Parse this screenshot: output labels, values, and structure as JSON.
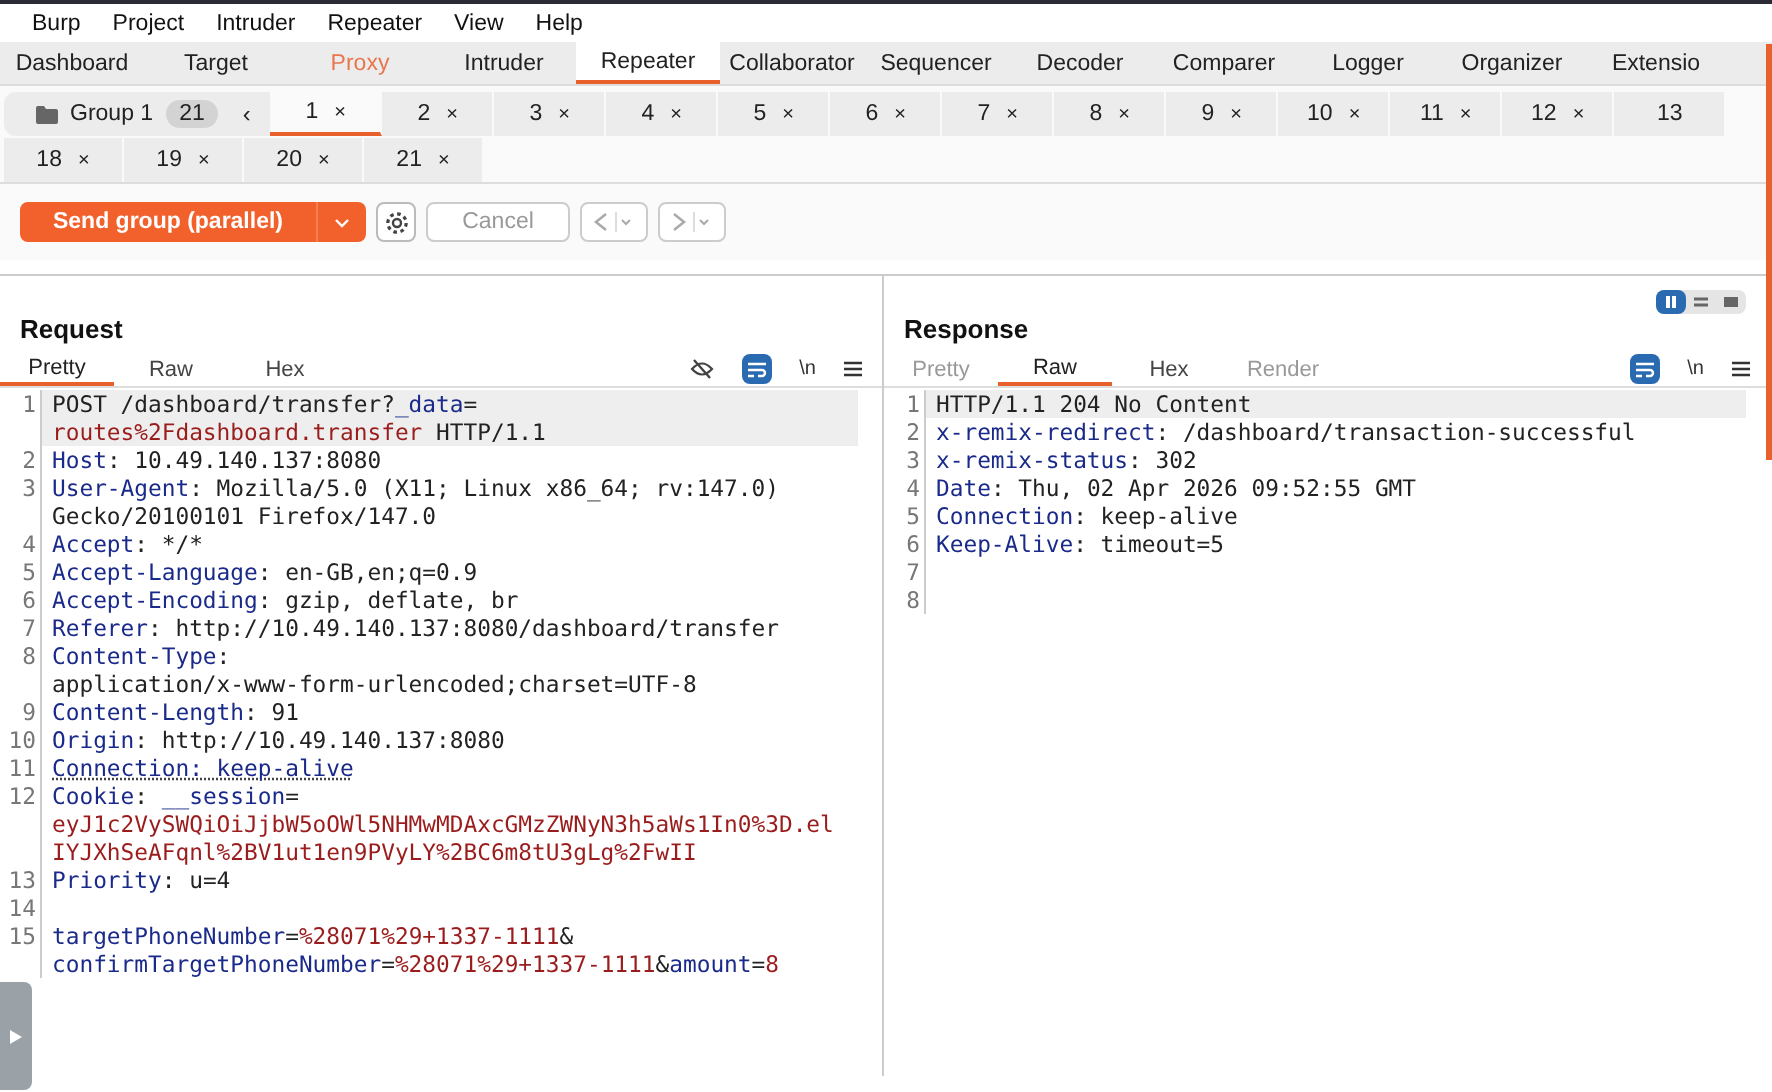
{
  "menu": [
    "Burp",
    "Project",
    "Intruder",
    "Repeater",
    "View",
    "Help"
  ],
  "main_tabs": [
    {
      "label": "Dashboard",
      "selected": false,
      "highlighted": false
    },
    {
      "label": "Target",
      "selected": false,
      "highlighted": false
    },
    {
      "label": "Proxy",
      "selected": false,
      "highlighted": true
    },
    {
      "label": "Intruder",
      "selected": false,
      "highlighted": false
    },
    {
      "label": "Repeater",
      "selected": true,
      "highlighted": false
    },
    {
      "label": "Collaborator",
      "selected": false,
      "highlighted": false
    },
    {
      "label": "Sequencer",
      "selected": false,
      "highlighted": false
    },
    {
      "label": "Decoder",
      "selected": false,
      "highlighted": false
    },
    {
      "label": "Comparer",
      "selected": false,
      "highlighted": false
    },
    {
      "label": "Logger",
      "selected": false,
      "highlighted": false
    },
    {
      "label": "Organizer",
      "selected": false,
      "highlighted": false
    },
    {
      "label": "Extensio",
      "selected": false,
      "highlighted": false
    }
  ],
  "group": {
    "name": "Group 1",
    "count": "21",
    "collapse": "‹"
  },
  "request_tabs_row1": [
    {
      "label": "1",
      "close": "×",
      "selected": true
    },
    {
      "label": "2",
      "close": "×",
      "selected": false
    },
    {
      "label": "3",
      "close": "×",
      "selected": false
    },
    {
      "label": "4",
      "close": "×",
      "selected": false
    },
    {
      "label": "5",
      "close": "×",
      "selected": false
    },
    {
      "label": "6",
      "close": "×",
      "selected": false
    },
    {
      "label": "7",
      "close": "×",
      "selected": false
    },
    {
      "label": "8",
      "close": "×",
      "selected": false
    },
    {
      "label": "9",
      "close": "×",
      "selected": false
    },
    {
      "label": "10",
      "close": "×",
      "selected": false
    },
    {
      "label": "11",
      "close": "×",
      "selected": false
    },
    {
      "label": "12",
      "close": "×",
      "selected": false
    },
    {
      "label": "13",
      "selected": false
    }
  ],
  "request_tabs_row2": [
    {
      "label": "18",
      "close": "×",
      "selected": false
    },
    {
      "label": "19",
      "close": "×",
      "selected": false
    },
    {
      "label": "20",
      "close": "×",
      "selected": false
    },
    {
      "label": "21",
      "close": "×",
      "selected": false
    }
  ],
  "toolbar": {
    "send": "Send group (parallel)",
    "cancel": "Cancel",
    "cancel_disabled": true
  },
  "request": {
    "title": "Request",
    "tabs": [
      {
        "label": "Pretty",
        "selected": true
      },
      {
        "label": "Raw",
        "selected": false
      },
      {
        "label": "Hex",
        "selected": false
      }
    ],
    "newline_toggle": "\\n",
    "lines": [
      {
        "no": "1",
        "rows": [
          {
            "parts": [
              {
                "kind": "plain",
                "text": "POST /dashboard/transfer?"
              },
              {
                "kind": "name",
                "text": "_data"
              },
              {
                "kind": "plain",
                "text": "="
              }
            ]
          },
          {
            "parts": [
              {
                "kind": "value",
                "text": "routes%2Fdashboard.transfer"
              },
              {
                "kind": "plain",
                "text": " HTTP/1.1"
              }
            ]
          }
        ]
      },
      {
        "no": "2",
        "rows": [
          {
            "parts": [
              {
                "kind": "name",
                "text": "Host"
              },
              {
                "kind": "plain",
                "text": ": 10.49.140.137:8080"
              }
            ]
          }
        ]
      },
      {
        "no": "3",
        "rows": [
          {
            "parts": [
              {
                "kind": "name",
                "text": "User-Agent"
              },
              {
                "kind": "plain",
                "text": ": Mozilla/5.0 (X11; Linux x86_64; rv:147.0)"
              }
            ]
          },
          {
            "parts": [
              {
                "kind": "plain",
                "text": "Gecko/20100101 Firefox/147.0"
              }
            ]
          }
        ]
      },
      {
        "no": "4",
        "rows": [
          {
            "parts": [
              {
                "kind": "name",
                "text": "Accept"
              },
              {
                "kind": "plain",
                "text": ": */*"
              }
            ]
          }
        ]
      },
      {
        "no": "5",
        "rows": [
          {
            "parts": [
              {
                "kind": "name",
                "text": "Accept-Language"
              },
              {
                "kind": "plain",
                "text": ": en-GB,en;q=0.9"
              }
            ]
          }
        ]
      },
      {
        "no": "6",
        "rows": [
          {
            "parts": [
              {
                "kind": "name",
                "text": "Accept-Encoding"
              },
              {
                "kind": "plain",
                "text": ": gzip, deflate, br"
              }
            ]
          }
        ]
      },
      {
        "no": "7",
        "rows": [
          {
            "parts": [
              {
                "kind": "name",
                "text": "Referer"
              },
              {
                "kind": "plain",
                "text": ": http://10.49.140.137:8080/dashboard/transfer"
              }
            ]
          }
        ]
      },
      {
        "no": "8",
        "rows": [
          {
            "parts": [
              {
                "kind": "name",
                "text": "Content-Type"
              },
              {
                "kind": "plain",
                "text": ":"
              }
            ]
          },
          {
            "parts": [
              {
                "kind": "plain",
                "text": "application/x-www-form-urlencoded;charset=UTF-8"
              }
            ]
          }
        ]
      },
      {
        "no": "9",
        "rows": [
          {
            "parts": [
              {
                "kind": "name",
                "text": "Content-Length"
              },
              {
                "kind": "plain",
                "text": ": 91"
              }
            ]
          }
        ]
      },
      {
        "no": "10",
        "rows": [
          {
            "parts": [
              {
                "kind": "name",
                "text": "Origin"
              },
              {
                "kind": "plain",
                "text": ": http://10.49.140.137:8080"
              }
            ]
          }
        ]
      },
      {
        "no": "11",
        "rows": [
          {
            "parts": [
              {
                "kind": "flagged",
                "text": "Connection: keep-alive"
              }
            ]
          }
        ]
      },
      {
        "no": "12",
        "rows": [
          {
            "parts": [
              {
                "kind": "name",
                "text": "Cookie"
              },
              {
                "kind": "plain",
                "text": ": "
              },
              {
                "kind": "name",
                "text": "__session"
              },
              {
                "kind": "plain",
                "text": "="
              }
            ]
          },
          {
            "parts": [
              {
                "kind": "value",
                "text": "eyJ1c2VySWQiOiJjbW5oOWl5NHMwMDAxcGMzZWNyN3h5aWs1In0%3D.el"
              }
            ]
          },
          {
            "parts": [
              {
                "kind": "value",
                "text": "IYJXhSeAFqnl%2BV1ut1en9PVyLY%2BC6m8tU3gLg%2FwII"
              }
            ]
          }
        ]
      },
      {
        "no": "13",
        "rows": [
          {
            "parts": [
              {
                "kind": "name",
                "text": "Priority"
              },
              {
                "kind": "plain",
                "text": ": u=4"
              }
            ]
          }
        ]
      },
      {
        "no": "14"
      },
      {
        "no": "15",
        "rows": [
          {
            "parts": [
              {
                "kind": "name",
                "text": "targetPhoneNumber"
              },
              {
                "kind": "plain",
                "text": "="
              },
              {
                "kind": "value",
                "text": "%28071%29+1337-1111"
              },
              {
                "kind": "plain",
                "text": "&"
              }
            ]
          },
          {
            "parts": [
              {
                "kind": "name",
                "text": "confirmTargetPhoneNumber"
              },
              {
                "kind": "plain",
                "text": "="
              },
              {
                "kind": "value",
                "text": "%28071%29+1337-1111"
              },
              {
                "kind": "plain",
                "text": "&"
              },
              {
                "kind": "name",
                "text": "amount"
              },
              {
                "kind": "plain",
                "text": "="
              },
              {
                "kind": "value",
                "text": "8"
              }
            ]
          }
        ]
      }
    ]
  },
  "response": {
    "title": "Response",
    "tabs": [
      {
        "label": "Pretty",
        "selected": false
      },
      {
        "label": "Raw",
        "selected": true
      },
      {
        "label": "Hex",
        "selected": false
      },
      {
        "label": "Render",
        "selected": false
      }
    ],
    "newline_toggle": "\\n",
    "lines": [
      {
        "no": "1",
        "rows": [
          {
            "parts": [
              {
                "kind": "plain",
                "text": "HTTP/1.1 204 No Content"
              }
            ]
          }
        ]
      },
      {
        "no": "2",
        "rows": [
          {
            "parts": [
              {
                "kind": "name",
                "text": "x-remix-redirect"
              },
              {
                "kind": "plain",
                "text": ": /dashboard/transaction-successful"
              }
            ]
          }
        ]
      },
      {
        "no": "3",
        "rows": [
          {
            "parts": [
              {
                "kind": "name",
                "text": "x-remix-status"
              },
              {
                "kind": "plain",
                "text": ": 302"
              }
            ]
          }
        ]
      },
      {
        "no": "4",
        "rows": [
          {
            "parts": [
              {
                "kind": "name",
                "text": "Date"
              },
              {
                "kind": "plain",
                "text": ": Thu, 02 Apr 2026 09:52:55 GMT"
              }
            ]
          }
        ]
      },
      {
        "no": "5",
        "rows": [
          {
            "parts": [
              {
                "kind": "name",
                "text": "Connection"
              },
              {
                "kind": "plain",
                "text": ": keep-alive"
              }
            ]
          }
        ]
      },
      {
        "no": "6",
        "rows": [
          {
            "parts": [
              {
                "kind": "name",
                "text": "Keep-Alive"
              },
              {
                "kind": "plain",
                "text": ": timeout=5"
              }
            ]
          }
        ]
      },
      {
        "no": "7"
      },
      {
        "no": "8"
      }
    ]
  },
  "layout_toggle": [
    {
      "kind": "columns",
      "selected": true
    },
    {
      "kind": "rows",
      "selected": false
    },
    {
      "kind": "single",
      "selected": false
    }
  ]
}
